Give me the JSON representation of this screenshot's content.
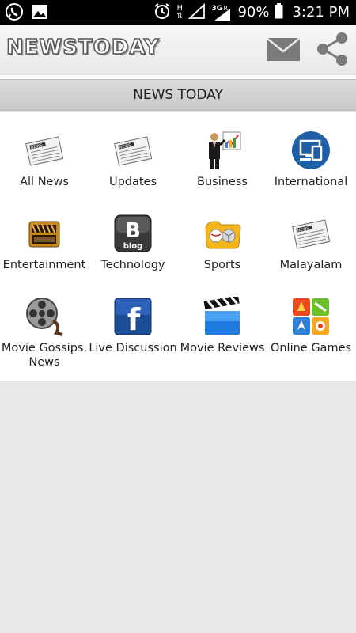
{
  "status_bar": {
    "battery": "90%",
    "time": "3:21 PM",
    "network": "3G",
    "network_sub": "R",
    "h_indicator": "H"
  },
  "app_bar": {
    "logo_text": "NEWSTODAY"
  },
  "section": {
    "title": "NEWS TODAY"
  },
  "tiles": [
    {
      "label": "All News",
      "icon": "newspaper-icon"
    },
    {
      "label": "Updates",
      "icon": "newspaper-icon"
    },
    {
      "label": "Business",
      "icon": "businessman-chart-icon"
    },
    {
      "label": "International",
      "icon": "devices-globe-icon"
    },
    {
      "label": "Entertainment",
      "icon": "clapperboard-icon"
    },
    {
      "label": "Technology",
      "icon": "blog-icon"
    },
    {
      "label": "Sports",
      "icon": "sports-balls-icon"
    },
    {
      "label": "Malayalam",
      "icon": "newspaper-icon"
    },
    {
      "label": "Movie Gossips, News",
      "icon": "film-reel-icon"
    },
    {
      "label": "Live Discussion",
      "icon": "facebook-icon"
    },
    {
      "label": "Movie Reviews",
      "icon": "movie-clapper-icon"
    },
    {
      "label": "Online Games",
      "icon": "games-icon"
    }
  ],
  "colors": {
    "status_bar_bg": "#000000",
    "header_bg": "#d0d0d0",
    "grid_bg": "#ffffff",
    "page_bg": "#e8e8e8",
    "icon_gray": "#777777"
  }
}
